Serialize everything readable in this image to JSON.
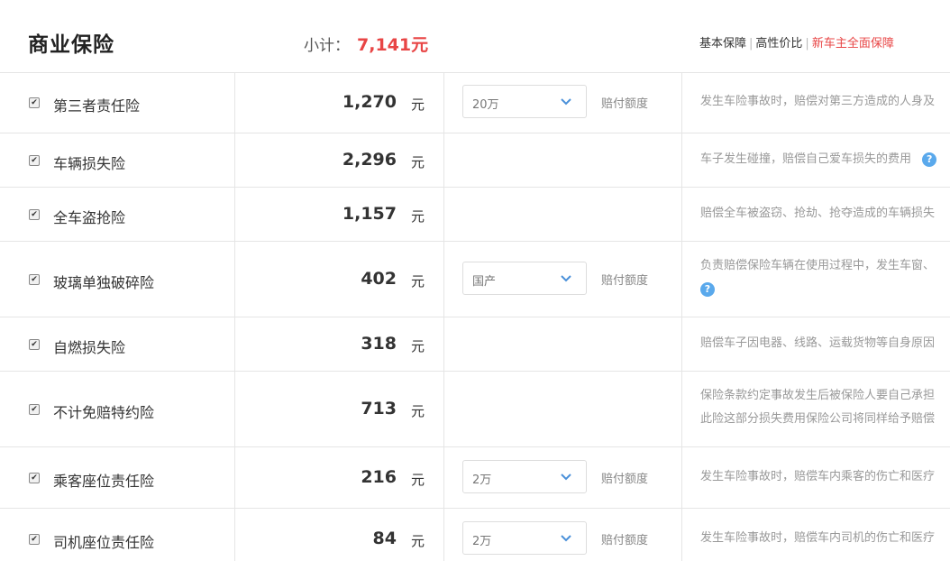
{
  "header": {
    "title": "商业保险",
    "subtotal_label": "小计：",
    "subtotal_value": "7,141元",
    "tabs": [
      "基本保障",
      "高性价比",
      "新车主全面保障"
    ]
  },
  "colors": {
    "accent_red": "#e84545",
    "help_blue": "#5aa9ec",
    "border": "#e5e5e5"
  },
  "unit_label": "元",
  "select_label": "赔付额度",
  "rows": [
    {
      "name": "第三者责任险",
      "price": "1,270",
      "select": "20万",
      "desc": "发生车险事故时，赔偿对第三方造成的人身及"
    },
    {
      "name": "车辆损失险",
      "price": "2,296",
      "desc": "车子发生碰撞，赔偿自己爱车损失的费用"
    },
    {
      "name": "全车盗抢险",
      "price": "1,157",
      "desc": "赔偿全车被盗窃、抢劫、抢夺造成的车辆损失"
    },
    {
      "name": "玻璃单独破碎险",
      "price": "402",
      "select": "国产",
      "desc": "负责赔偿保险车辆在使用过程中，发生车窗、"
    },
    {
      "name": "自燃损失险",
      "price": "318",
      "desc": "赔偿车子因电器、线路、运载货物等自身原因"
    },
    {
      "name": "不计免赔特约险",
      "price": "713",
      "desc": "保险条款约定事故发生后被保险人要自己承担",
      "desc2": "此险这部分损失费用保险公司将同样给予赔偿"
    },
    {
      "name": "乘客座位责任险",
      "price": "216",
      "select": "2万",
      "desc": "发生车险事故时，赔偿车内乘客的伤亡和医疗"
    },
    {
      "name": "司机座位责任险",
      "price": "84",
      "select": "2万",
      "desc": "发生车险事故时，赔偿车内司机的伤亡和医疗"
    }
  ]
}
